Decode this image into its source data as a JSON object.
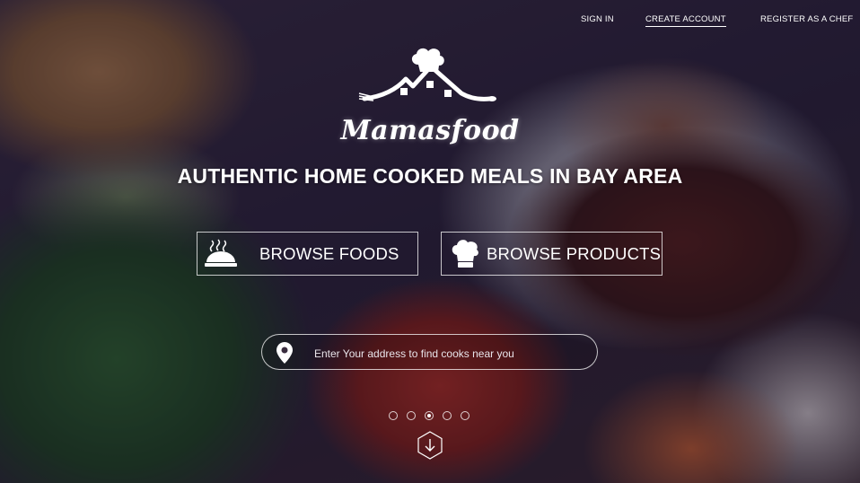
{
  "nav": {
    "sign_in": "SIGN IN",
    "create_account": "CREATE ACCOUNT",
    "register_chef": "REGISTER AS A CHEF"
  },
  "brand": {
    "name": "Mamasfood",
    "logo_icon": "chef-hat-house-icon"
  },
  "hero": {
    "tagline": "AUTHENTIC HOME COOKED MEALS IN BAY AREA"
  },
  "actions": {
    "browse_foods": {
      "label": "BROWSE FOODS",
      "icon": "serving-cloche-icon"
    },
    "browse_products": {
      "label": "BROWSE PRODUCTS",
      "icon": "chef-hat-icon"
    }
  },
  "search": {
    "placeholder": "Enter Your address to find cooks near you",
    "value": "",
    "icon": "location-pin-icon"
  },
  "carousel": {
    "slides": 5,
    "active_index": 2
  },
  "scroll": {
    "icon": "scroll-down-arrow-icon"
  },
  "colors": {
    "text": "#ffffff",
    "overlay": "#140a28"
  }
}
